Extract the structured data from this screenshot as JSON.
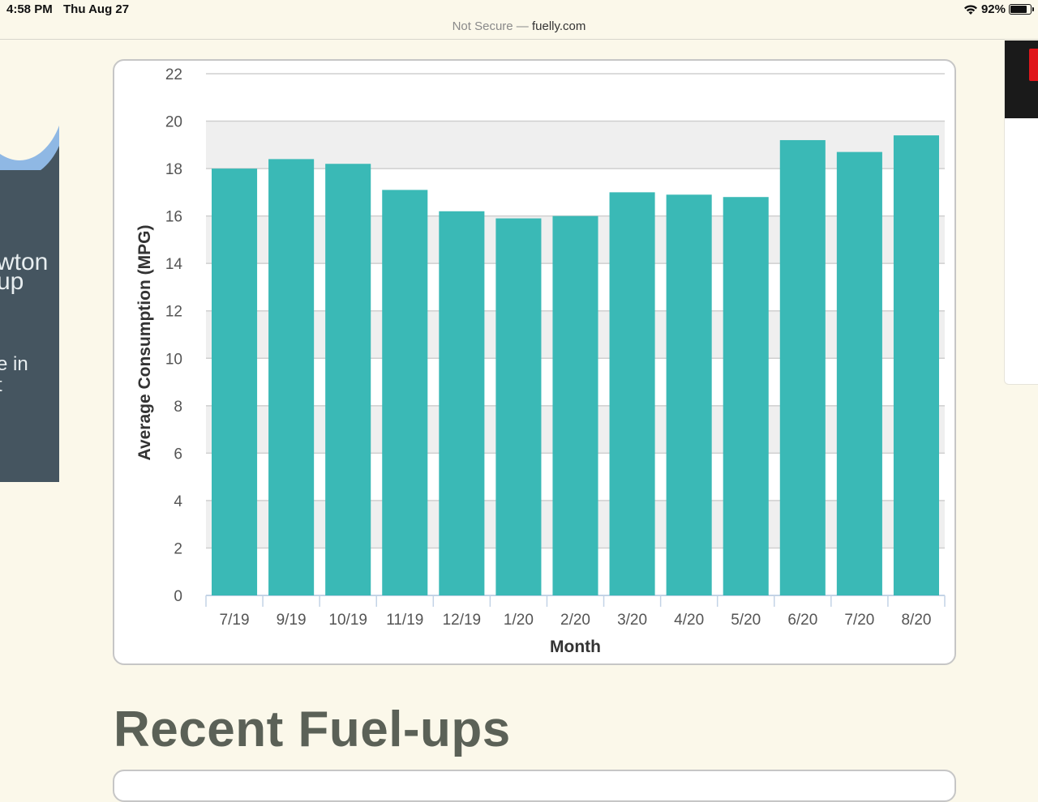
{
  "status_bar": {
    "time": "4:58 PM",
    "date": "Thu Aug 27",
    "battery": "92%",
    "battery_level": 0.92
  },
  "address_bar": {
    "security": "Not Secure — ",
    "domain": "fuelly.com"
  },
  "left_ad": {
    "line1": "wton\nup",
    "line2": "e in\nt"
  },
  "section": {
    "heading": "Recent Fuel-ups"
  },
  "colors": {
    "bar": "#3ab9b6",
    "band": "#efefef",
    "page_bg": "#fbf8ea"
  },
  "chart_data": {
    "type": "bar",
    "categories": [
      "7/19",
      "9/19",
      "10/19",
      "11/19",
      "12/19",
      "1/20",
      "2/20",
      "3/20",
      "4/20",
      "5/20",
      "6/20",
      "7/20",
      "8/20"
    ],
    "values": [
      18.0,
      18.4,
      18.2,
      17.1,
      16.2,
      15.9,
      16.0,
      17.0,
      16.9,
      16.8,
      19.2,
      18.7,
      19.4
    ],
    "xlabel": "Month",
    "ylabel": "Average Consumption (MPG)",
    "ylim": [
      0,
      22
    ],
    "yticks": [
      0,
      2,
      4,
      6,
      8,
      10,
      12,
      14,
      16,
      18,
      20,
      22
    ],
    "grid": true
  }
}
